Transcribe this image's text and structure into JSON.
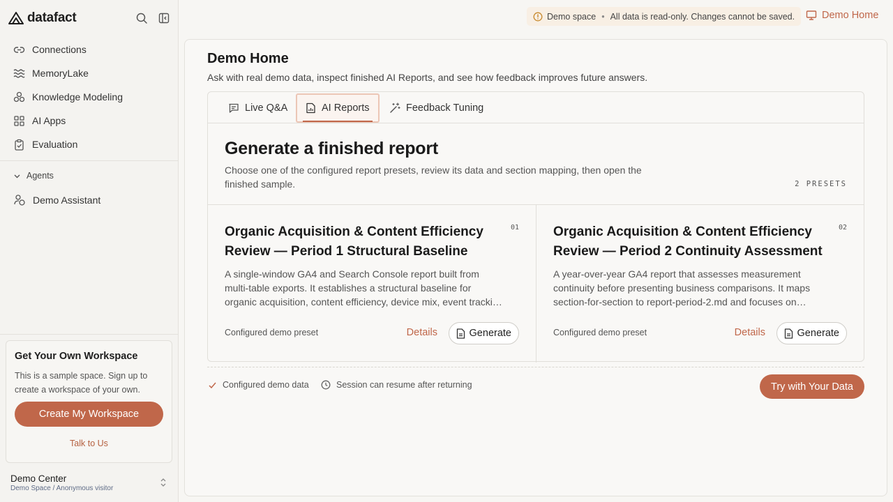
{
  "app": {
    "name": "datafact"
  },
  "sidebar": {
    "items": [
      {
        "label": "Connections",
        "icon": "link-icon"
      },
      {
        "label": "MemoryLake",
        "icon": "waves-icon"
      },
      {
        "label": "Knowledge Modeling",
        "icon": "cluster-icon"
      },
      {
        "label": "AI Apps",
        "icon": "grid-icon"
      },
      {
        "label": "Evaluation",
        "icon": "clipboard-check-icon"
      }
    ],
    "agents_label": "Agents",
    "agent": "Demo Assistant",
    "promo": {
      "title": "Get Your Own Workspace",
      "text": "This is a sample space. Sign up to create a workspace of your own.",
      "button": "Create My Workspace",
      "link": "Talk to Us"
    },
    "account": {
      "name": "Demo Center",
      "sub": "Demo Space / Anonymous visitor"
    }
  },
  "topbar": {
    "notice_label": "Demo space",
    "notice_text": "All data is read-only. Changes cannot be saved.",
    "home_link": "Demo Home"
  },
  "main": {
    "title": "Demo Home",
    "subtitle": "Ask with real demo data, inspect finished AI Reports, and see how feedback improves future answers.",
    "tabs": [
      {
        "label": "Live Q&A",
        "icon": "chat-icon"
      },
      {
        "label": "AI Reports",
        "icon": "report-icon"
      },
      {
        "label": "Feedback Tuning",
        "icon": "magic-wand-icon"
      }
    ],
    "generate": {
      "title": "Generate a finished report",
      "description": "Choose one of the configured report presets, review its data and section mapping, then open the finished sample.",
      "count": "2 PRESETS"
    },
    "presets": [
      {
        "number": "01",
        "title": "Organic Acquisition & Content Efficiency Review — Period 1 Structural Baseline",
        "description": "A single-window GA4 and Search Console report built from multi-table exports. It establishes a structural baseline for organic acquisition, content efficiency, device mix, event tracking and conversion quality.",
        "footer": "Configured demo preset",
        "details": "Details",
        "generate": "Generate"
      },
      {
        "number": "02",
        "title": "Organic Acquisition & Content Efficiency Review — Period 2 Continuity Assessment",
        "description": "A year-over-year GA4 report that assesses measurement continuity before presenting business comparisons. It maps section-for-section to report-period-2.md and focuses on continuity of tracking.",
        "footer": "Configured demo preset",
        "details": "Details",
        "generate": "Generate"
      }
    ],
    "footer": {
      "item1": "Configured demo data",
      "item2": "Session can resume after returning",
      "cta": "Try with Your Data"
    }
  },
  "colors": {
    "accent": "#c0674a",
    "notice_bg": "#f8efe4"
  }
}
